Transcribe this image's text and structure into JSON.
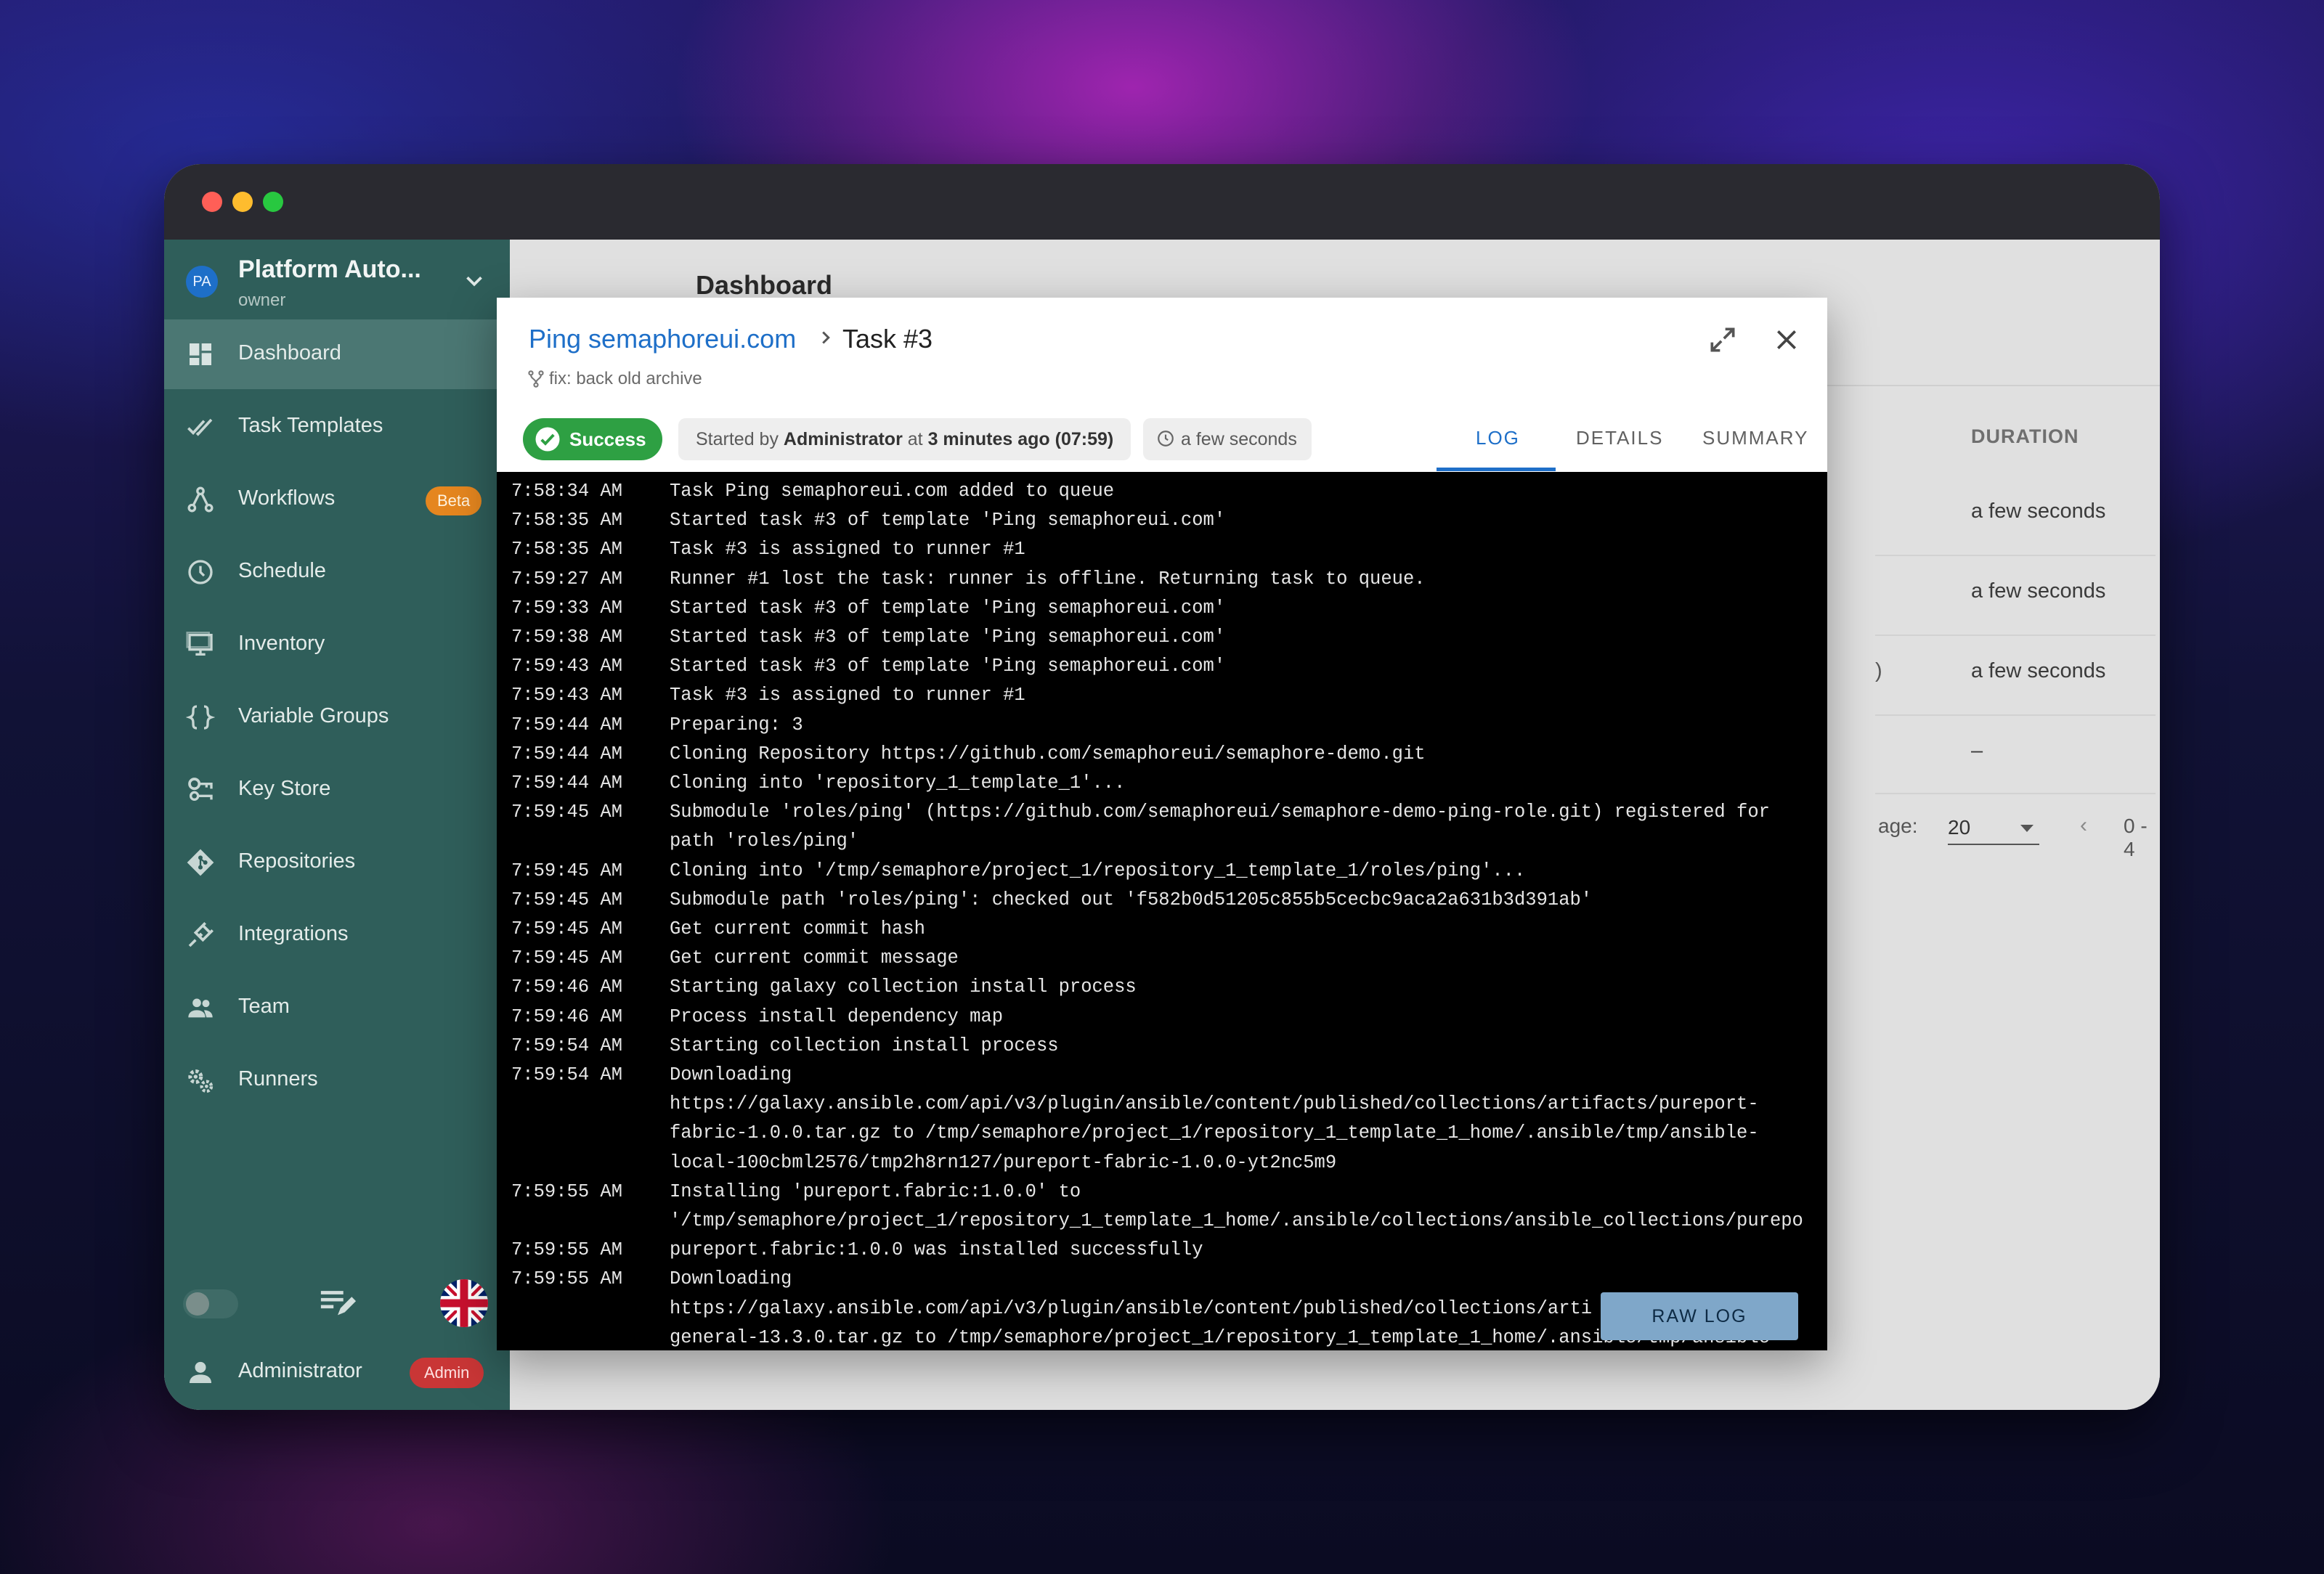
{
  "window": {
    "traffic_lights": [
      "close",
      "minimize",
      "maximize"
    ]
  },
  "sidebar": {
    "project": {
      "avatar": "PA",
      "name": "Platform Auto...",
      "role": "owner"
    },
    "items": [
      {
        "label": "Dashboard",
        "icon": "dashboard-icon",
        "active": true
      },
      {
        "label": "Task Templates",
        "icon": "checks-icon"
      },
      {
        "label": "Workflows",
        "icon": "workflow-icon",
        "badge": "Beta"
      },
      {
        "label": "Schedule",
        "icon": "clock-icon"
      },
      {
        "label": "Inventory",
        "icon": "monitor-icon"
      },
      {
        "label": "Variable Groups",
        "icon": "braces-icon"
      },
      {
        "label": "Key Store",
        "icon": "key-icon"
      },
      {
        "label": "Repositories",
        "icon": "git-icon"
      },
      {
        "label": "Integrations",
        "icon": "plug-icon"
      },
      {
        "label": "Team",
        "icon": "people-icon"
      },
      {
        "label": "Runners",
        "icon": "cogs-icon"
      }
    ],
    "user": {
      "name": "Administrator",
      "badge": "Admin"
    }
  },
  "main": {
    "title": "Dashboard",
    "table": {
      "duration_header": "DURATION",
      "durations": [
        "a few seconds",
        "a few seconds",
        "a few seconds",
        "–"
      ],
      "partial_text": ")"
    },
    "pagination": {
      "label": "age:",
      "per_page": "20",
      "range": "0 - 4"
    }
  },
  "dialog": {
    "template_link": "Ping semaphoreui.com",
    "task_title": "Task #3",
    "commit_message": "fix: back old archive",
    "status": "Success",
    "started": {
      "prefix": "Started by",
      "user": "Administrator",
      "at": "at",
      "when": "3 minutes ago (07:59)"
    },
    "duration": "a few seconds",
    "tabs": [
      "LOG",
      "DETAILS",
      "SUMMARY"
    ],
    "active_tab": "LOG",
    "raw_log_button": "RAW LOG",
    "colors": {
      "accent": "#1e6fc8",
      "success": "#2ea043",
      "sidebar": "#2f5e5a",
      "admin_badge": "#c93636",
      "beta_badge": "#e5861f"
    },
    "log": [
      {
        "time": "7:58:34 AM",
        "text": "Task Ping semaphoreui.com added to queue"
      },
      {
        "time": "7:58:35 AM",
        "text": "Started task #3 of template 'Ping semaphoreui.com'"
      },
      {
        "time": "7:58:35 AM",
        "text": "Task #3 is assigned to runner #1"
      },
      {
        "time": "7:59:27 AM",
        "text": "Runner #1 lost the task: runner is offline. Returning task to queue."
      },
      {
        "time": "7:59:33 AM",
        "text": "Started task #3 of template 'Ping semaphoreui.com'"
      },
      {
        "time": "7:59:38 AM",
        "text": "Started task #3 of template 'Ping semaphoreui.com'"
      },
      {
        "time": "7:59:43 AM",
        "text": "Started task #3 of template 'Ping semaphoreui.com'"
      },
      {
        "time": "7:59:43 AM",
        "text": "Task #3 is assigned to runner #1"
      },
      {
        "time": "7:59:44 AM",
        "text": "Preparing: 3"
      },
      {
        "time": "7:59:44 AM",
        "text": "Cloning Repository https://github.com/semaphoreui/semaphore-demo.git"
      },
      {
        "time": "7:59:44 AM",
        "text": "Cloning into 'repository_1_template_1'..."
      },
      {
        "time": "7:59:45 AM",
        "text": "Submodule 'roles/ping' (https://github.com/semaphoreui/semaphore-demo-ping-role.git) registered for"
      },
      {
        "time": "",
        "text": "path 'roles/ping'"
      },
      {
        "time": "7:59:45 AM",
        "text": "Cloning into '/tmp/semaphore/project_1/repository_1_template_1/roles/ping'..."
      },
      {
        "time": "7:59:45 AM",
        "text": "Submodule path 'roles/ping': checked out 'f582b0d51205c855b5cecbc9aca2a631b3d391ab'"
      },
      {
        "time": "7:59:45 AM",
        "text": "Get current commit hash"
      },
      {
        "time": "7:59:45 AM",
        "text": "Get current commit message"
      },
      {
        "time": "7:59:46 AM",
        "text": "Starting galaxy collection install process"
      },
      {
        "time": "7:59:46 AM",
        "text": "Process install dependency map"
      },
      {
        "time": "7:59:54 AM",
        "text": "Starting collection install process"
      },
      {
        "time": "7:59:54 AM",
        "text": "Downloading"
      },
      {
        "time": "",
        "text": "https://galaxy.ansible.com/api/v3/plugin/ansible/content/published/collections/artifacts/pureport-"
      },
      {
        "time": "",
        "text": "fabric-1.0.0.tar.gz to /tmp/semaphore/project_1/repository_1_template_1_home/.ansible/tmp/ansible-"
      },
      {
        "time": "",
        "text": "local-100cbml2576/tmp2h8rn127/pureport-fabric-1.0.0-yt2nc5m9"
      },
      {
        "time": "7:59:55 AM",
        "text": "Installing 'pureport.fabric:1.0.0' to"
      },
      {
        "time": "",
        "text": "'/tmp/semaphore/project_1/repository_1_template_1_home/.ansible/collections/ansible_collections/purepo"
      },
      {
        "time": "7:59:55 AM",
        "text": "pureport.fabric:1.0.0 was installed successfully"
      },
      {
        "time": "7:59:55 AM",
        "text": "Downloading"
      },
      {
        "time": "",
        "text": "https://galaxy.ansible.com/api/v3/plugin/ansible/content/published/collections/arti"
      },
      {
        "time": "",
        "text": "general-13.3.0.tar.gz to /tmp/semaphore/project_1/repository_1_template_1_home/.ansible/tmp/ansible-"
      }
    ]
  }
}
